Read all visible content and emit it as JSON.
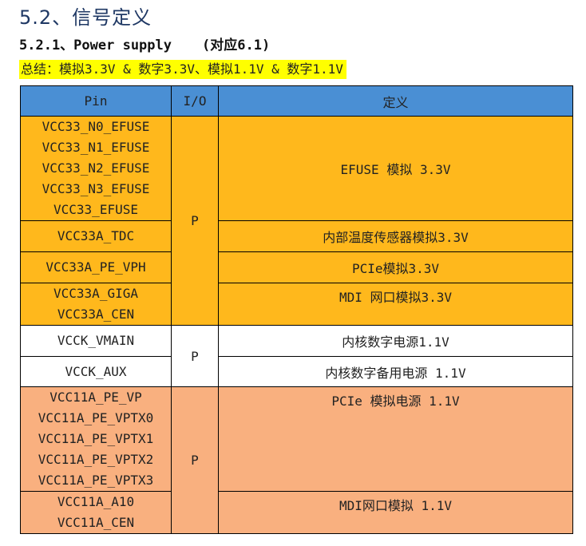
{
  "heading": "5.2、信号定义",
  "subheading": {
    "title": "5.2.1、Power supply",
    "note": "(对应6.1)"
  },
  "summary": "总结：模拟3.3V & 数字3.3V、模拟1.1V & 数字1.1V",
  "table": {
    "headers": [
      "Pin",
      "I/O",
      "定义"
    ],
    "rows": {
      "efuse": {
        "pins": [
          "VCC33_N0_EFUSE",
          "VCC33_N1_EFUSE",
          "VCC33_N2_EFUSE",
          "VCC33_N3_EFUSE",
          "VCC33_EFUSE"
        ],
        "def": "EFUSE 模拟 3.3V"
      },
      "tdc": {
        "pins": [
          "VCC33A_TDC"
        ],
        "def": "内部温度传感器模拟3.3V"
      },
      "pe_vph": {
        "pins": [
          "VCC33A_PE_VPH"
        ],
        "def": "PCIe模拟3.3V"
      },
      "giga": {
        "pins": [
          "VCC33A_GIGA",
          "VCC33A_CEN"
        ],
        "def": "MDI 网口模拟3.3V"
      },
      "vmain": {
        "pins": [
          "VCCK_VMAIN"
        ],
        "def": "内核数字电源1.1V"
      },
      "aux": {
        "pins": [
          "VCCK_AUX"
        ],
        "def": "内核数字备用电源 1.1V"
      },
      "pe_vp": {
        "pins": [
          "VCC11A_PE_VP",
          "VCC11A_PE_VPTX0",
          "VCC11A_PE_VPTX1",
          "VCC11A_PE_VPTX2",
          "VCC11A_PE_VPTX3"
        ],
        "def": "PCIe 模拟电源 1.1V"
      },
      "a10": {
        "pins": [
          "VCC11A_A10",
          "VCC11A_CEN"
        ],
        "def": "MDI网口模拟 1.1V"
      }
    },
    "io": {
      "group1": "P",
      "group2": "P",
      "group3": "P"
    },
    "colors": {
      "header": "#4a8fd4",
      "group1": "#ffb81c",
      "group2": "#ffffff",
      "group3": "#f9b07f"
    }
  }
}
